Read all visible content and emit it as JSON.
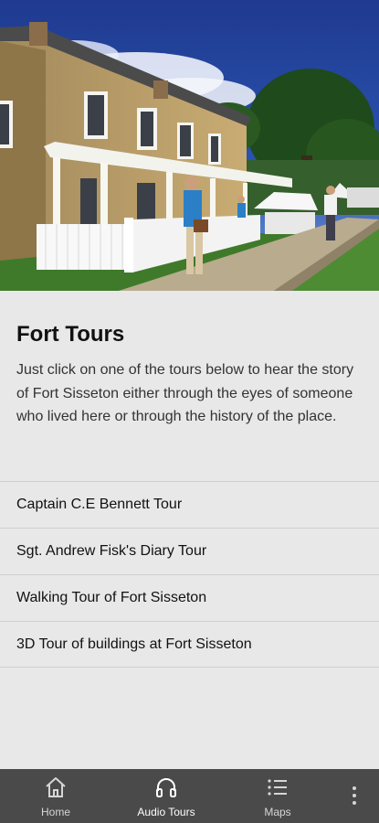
{
  "page": {
    "title": "Fort Tours",
    "description": "Just click on one of the tours below to hear the story of Fort Sisseton either through the eyes of someone who lived here or through the history of the place."
  },
  "tours": [
    {
      "label": "Captain C.E Bennett Tour"
    },
    {
      "label": "Sgt. Andrew Fisk's Diary Tour"
    },
    {
      "label": "Walking Tour of Fort Sisseton"
    },
    {
      "label": "3D Tour of buildings at Fort Sisseton"
    }
  ],
  "bottom_nav": {
    "items": [
      {
        "label": "Home",
        "icon": "home-icon"
      },
      {
        "label": "Audio Tours",
        "icon": "headphones-icon",
        "active": true
      },
      {
        "label": "Maps",
        "icon": "list-icon"
      }
    ],
    "more_icon": "more-vertical-icon"
  },
  "colors": {
    "background": "#e8e8e8",
    "nav_background": "#4a4a4a",
    "divider": "#cfcfcf"
  }
}
